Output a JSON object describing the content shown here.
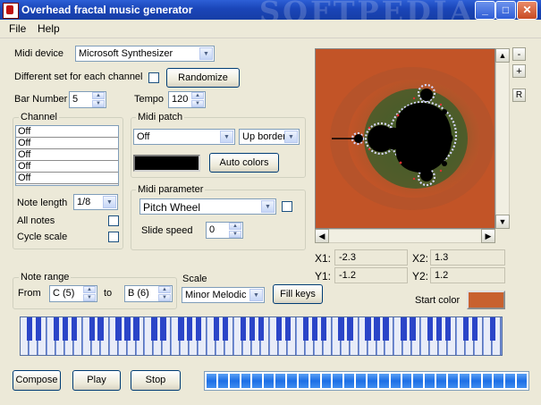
{
  "window": {
    "title": "Overhead fractal music generator",
    "watermark": "SOFTPEDIA"
  },
  "menu": {
    "file": "File",
    "help": "Help"
  },
  "midi_device": {
    "label": "Midi device",
    "value": "Microsoft Synthesizer"
  },
  "channels_option": {
    "label": "Different set for each channel",
    "checked": false
  },
  "randomize": {
    "label": "Randomize"
  },
  "bar_number": {
    "label": "Bar Number",
    "value": "5"
  },
  "tempo": {
    "label": "Tempo",
    "value": "120"
  },
  "channel": {
    "group": "Channel",
    "items": [
      "Off",
      "Off",
      "Off",
      "Off",
      "Off"
    ]
  },
  "note_length": {
    "label": "Note length",
    "value": "1/8"
  },
  "all_notes": {
    "label": "All notes",
    "checked": false
  },
  "cycle_scale": {
    "label": "Cycle scale",
    "checked": false
  },
  "midi_patch": {
    "group": "Midi patch",
    "value": "Off",
    "border": "Up border",
    "swatch_color": "#000000",
    "auto_colors": "Auto colors"
  },
  "midi_parameter": {
    "group": "Midi parameter",
    "value": "Pitch Wheel",
    "checked": false,
    "slide_label": "Slide speed",
    "slide_value": "0"
  },
  "note_range": {
    "group": "Note range",
    "from_label": "From",
    "from_value": "C (5)",
    "to_label": "to",
    "to_value": "B (6)"
  },
  "scale": {
    "label": "Scale",
    "value": "Minor Melodic",
    "fill_keys": "Fill keys"
  },
  "coords": {
    "x1_label": "X1:",
    "x1": "-2.3",
    "x2_label": "X2:",
    "x2": "1.3",
    "y1_label": "Y1:",
    "y1": "-1.2",
    "y2_label": "Y2:",
    "y2": "1.2"
  },
  "zoom": {
    "minus": "-",
    "plus": "+",
    "reset": "R"
  },
  "start_color": {
    "label": "Start color",
    "color": "#c8612f"
  },
  "buttons": {
    "compose": "Compose",
    "play": "Play",
    "stop": "Stop"
  },
  "progress": {
    "segments": 28
  },
  "colors": {
    "title_bar": "#1a45b8",
    "fractal_bg": "#c25427",
    "key_blue": "#2b45c8",
    "progress_blue": "#1d6fe6"
  }
}
